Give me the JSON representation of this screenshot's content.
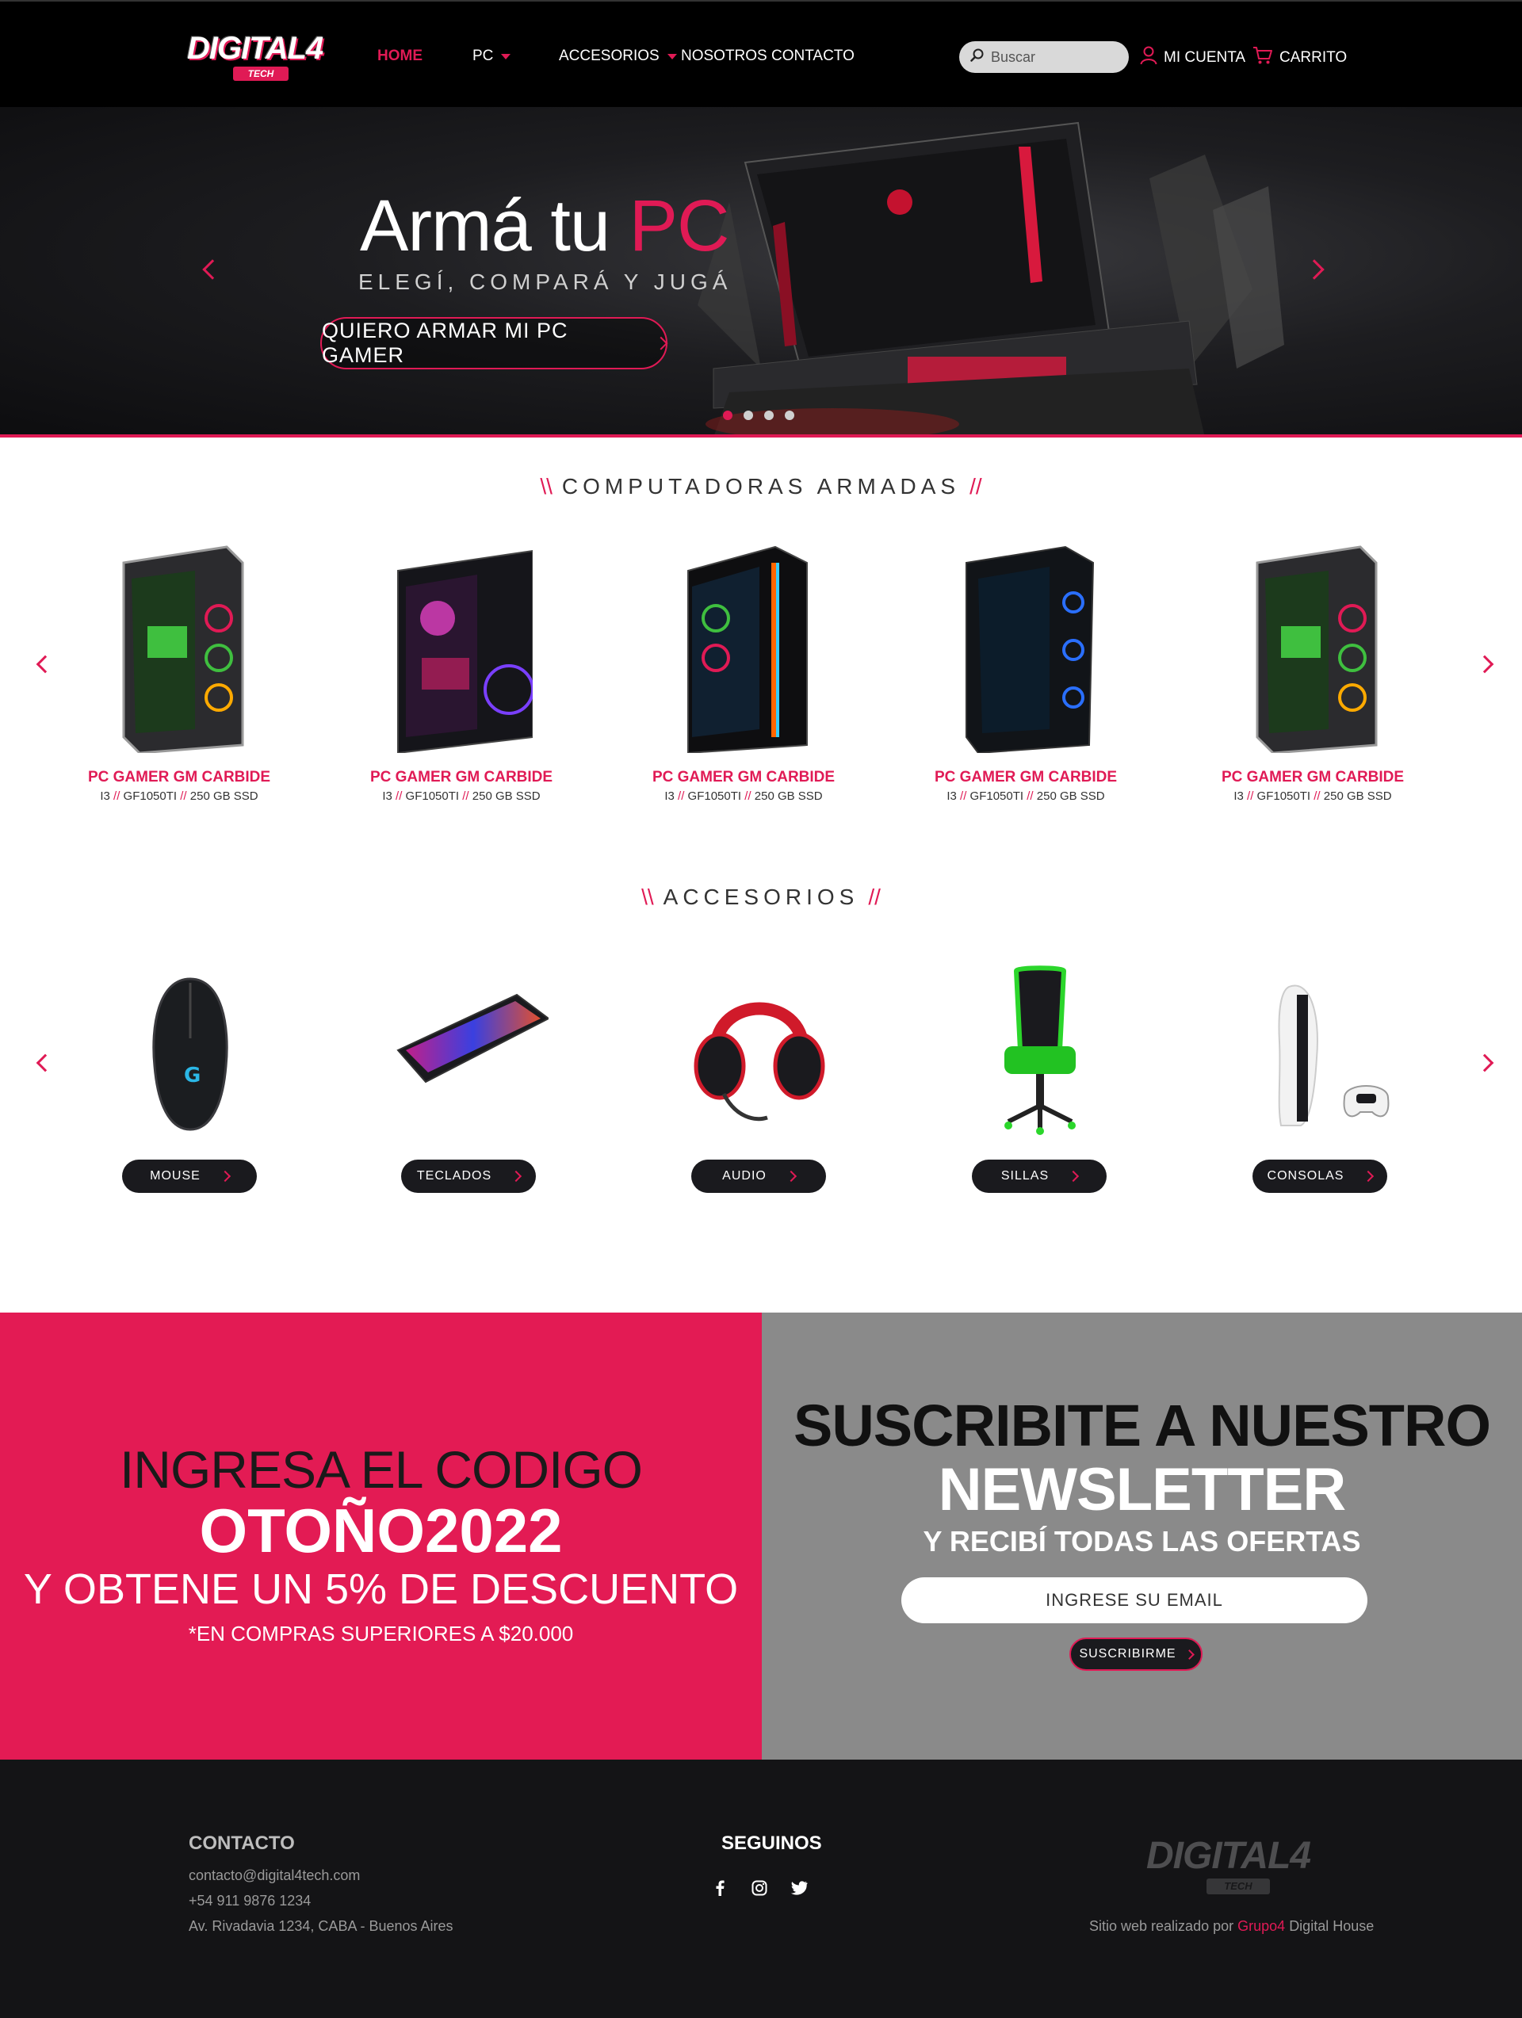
{
  "header": {
    "logo_text": "DIGITAL4",
    "logo_tag": "TECH",
    "nav": [
      {
        "label": "HOME",
        "active": true,
        "dropdown": false
      },
      {
        "label": "PC",
        "active": false,
        "dropdown": true
      },
      {
        "label": "ACCESORIOS",
        "active": false,
        "dropdown": true
      },
      {
        "label": "NOSOTROS",
        "active": false,
        "dropdown": false
      },
      {
        "label": "CONTACTO",
        "active": false,
        "dropdown": false
      }
    ],
    "search_placeholder": "Buscar",
    "account_label": "MI CUENTA",
    "cart_label": "CARRITO"
  },
  "hero": {
    "title_part1": "Armá tu",
    "title_part2": "PC",
    "subtitle": "ELEGÍ, COMPARÁ Y JUGÁ",
    "cta_label": "QUIERO ARMAR MI PC GAMER",
    "slides_total": 4,
    "active_slide": 1
  },
  "computers": {
    "title": "COMPUTADORAS ARMADAS",
    "items": [
      {
        "name": "PC GAMER GM CARBIDE",
        "cpu": "I3",
        "gpu": "GF1050TI",
        "storage": "250 GB SSD"
      },
      {
        "name": "PC GAMER GM CARBIDE",
        "cpu": "I3",
        "gpu": "GF1050TI",
        "storage": "250 GB SSD"
      },
      {
        "name": "PC GAMER GM CARBIDE",
        "cpu": "I3",
        "gpu": "GF1050TI",
        "storage": "250 GB SSD"
      },
      {
        "name": "PC GAMER GM CARBIDE",
        "cpu": "I3",
        "gpu": "GF1050TI",
        "storage": "250 GB SSD"
      },
      {
        "name": "PC GAMER GM CARBIDE",
        "cpu": "I3",
        "gpu": "GF1050TI",
        "storage": "250 GB SSD"
      }
    ]
  },
  "accessories": {
    "title": "ACCESORIOS",
    "items": [
      {
        "label": "MOUSE"
      },
      {
        "label": "TECLADOS"
      },
      {
        "label": "AUDIO"
      },
      {
        "label": "SILLAS"
      },
      {
        "label": "CONSOLAS"
      }
    ]
  },
  "promo": {
    "line1": "INGRESA EL CODIGO",
    "code": "OTOÑO2022",
    "line3": "Y OBTENE UN 5% DE DESCUENTO",
    "note": "*EN COMPRAS SUPERIORES A $20.000"
  },
  "newsletter": {
    "line1": "SUSCRIBITE A NUESTRO",
    "line2": "NEWSLETTER",
    "line3": "Y RECIBÍ TODAS LAS OFERTAS",
    "email_placeholder": "INGRESE SU EMAIL",
    "button_label": "SUSCRIBIRME"
  },
  "footer": {
    "contact_title": "CONTACTO",
    "email": "contacto@digital4tech.com",
    "phone": "+54 911 9876 1234",
    "address": "Av. Rivadavia 1234, CABA -  Buenos Aires",
    "follow_title": "SEGUINOS",
    "social": [
      "facebook-icon",
      "instagram-icon",
      "twitter-icon"
    ],
    "credit_prefix": "Sitio web realizado por",
    "credit_brand": "Grupo4",
    "credit_suffix": "Digital House"
  },
  "colors": {
    "accent": "#e01a55",
    "dark": "#000000",
    "promo_bg": "#e31b54",
    "news_bg": "#8a8a8a",
    "footer_bg": "#141416"
  }
}
